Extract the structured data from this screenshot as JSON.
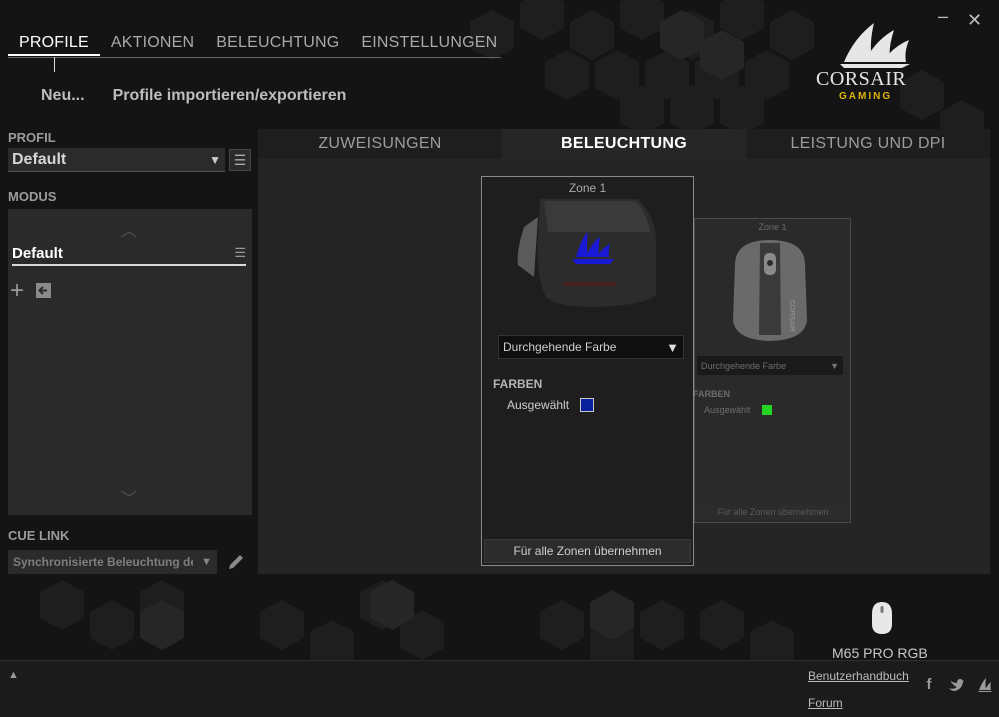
{
  "window": {
    "minimize_glyph": "–",
    "close_glyph": "✕"
  },
  "nav": {
    "tabs": [
      {
        "label": "PROFILE",
        "active": true
      },
      {
        "label": "AKTIONEN",
        "active": false
      },
      {
        "label": "BELEUCHTUNG",
        "active": false
      },
      {
        "label": "EINSTELLUNGEN",
        "active": false
      }
    ]
  },
  "profile_actions": {
    "new_label": "Neu...",
    "import_export_label": "Profile importieren/exportieren"
  },
  "brand": {
    "name": "CORSAIR",
    "sub": "GAMING",
    "accent": "#e0b30c"
  },
  "sidebar": {
    "profile_label": "PROFIL",
    "profile_value": "Default",
    "mode_label": "MODUS",
    "modes": [
      {
        "name": "Default"
      }
    ],
    "cue_link_label": "CUE LINK",
    "cue_link_value": "Synchronisierte Beleuchtung deaktiviert"
  },
  "subtabs": [
    {
      "label": "ZUWEISUNGEN",
      "active": false
    },
    {
      "label": "BELEUCHTUNG",
      "active": true
    },
    {
      "label": "LEISTUNG UND DPI",
      "active": false
    }
  ],
  "zone_active": {
    "title": "Zone 1",
    "effect": "Durchgehende Farbe",
    "colors_label": "FARBEN",
    "selected_label": "Ausgewählt",
    "selected_color": "#0a1f9a",
    "apply_label": "Für alle Zonen übernehmen"
  },
  "zone_ghost": {
    "title": "Zone 1",
    "effect": "Durchgehende Farbe",
    "colors_label": "FARBEN",
    "selected_label": "Ausgewählt",
    "selected_color": "#22d322",
    "apply_label": "Für alle Zonen übernehmen"
  },
  "device": {
    "name": "M65 PRO RGB"
  },
  "footer": {
    "manual_link": "Benutzerhandbuch",
    "forum_link": "Forum",
    "social_icons": [
      "facebook-icon",
      "twitter-icon",
      "corsair-icon"
    ]
  }
}
